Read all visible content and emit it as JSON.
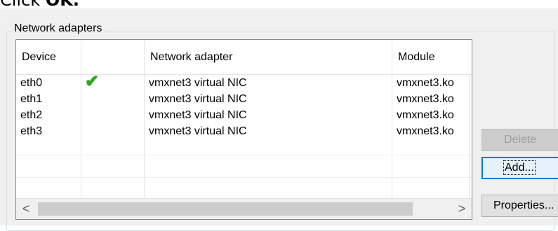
{
  "instruction": {
    "prefix": "Click ",
    "bold": "OK."
  },
  "group": {
    "title": "Network adapters"
  },
  "table": {
    "columns": [
      "Device",
      "",
      "Network adapter",
      "Module"
    ],
    "rows": [
      {
        "device": "eth0",
        "status": "check",
        "adapter": "vmxnet3 virtual NIC",
        "module": "vmxnet3.ko"
      },
      {
        "device": "eth1",
        "status": "",
        "adapter": "vmxnet3 virtual NIC",
        "module": "vmxnet3.ko"
      },
      {
        "device": "eth2",
        "status": "",
        "adapter": "vmxnet3 virtual NIC",
        "module": "vmxnet3.ko"
      },
      {
        "device": "eth3",
        "status": "",
        "adapter": "vmxnet3 virtual NIC",
        "module": "vmxnet3.ko"
      }
    ],
    "check_glyph": "✔",
    "check_color": "#2aa81a"
  },
  "scrollbar": {
    "left_arrow": "<",
    "right_arrow": ">"
  },
  "buttons": {
    "delete_label": "Delete",
    "add_label": "Add...",
    "properties_label": "Properties..."
  },
  "colors": {
    "window_bg": "#f0f0f0",
    "focus_blue": "#0078d7"
  }
}
